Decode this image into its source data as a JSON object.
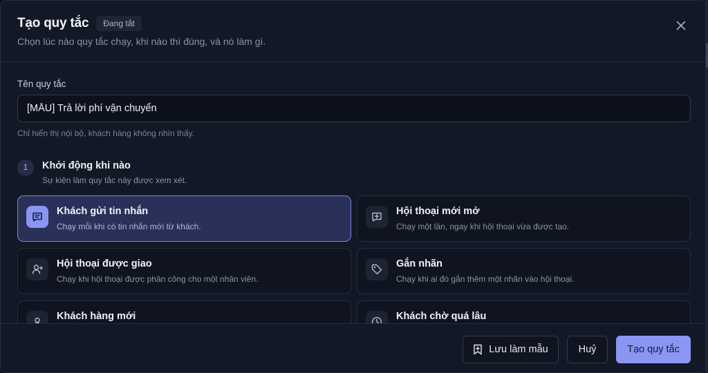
{
  "modal": {
    "title": "Tạo quy tắc",
    "status_badge": "Đang tắt",
    "subtitle": "Chọn lúc nào quy tắc chạy, khi nào thì đúng, và nó làm gì."
  },
  "form": {
    "name_label": "Tên quy tắc",
    "name_value": "[MẪU] Trả lời phí vận chuyển",
    "name_help": "Chỉ hiển thị nội bộ, khách hàng không nhìn thấy."
  },
  "step1": {
    "number": "1",
    "title": "Khởi động khi nào",
    "description": "Sự kiện làm quy tắc này được xem xét."
  },
  "triggers": [
    {
      "title": "Khách gửi tin nhắn",
      "description": "Chạy mỗi khi có tin nhắn mới từ khách.",
      "icon": "message-icon",
      "selected": true
    },
    {
      "title": "Hội thoại mới mở",
      "description": "Chạy một lần, ngay khi hội thoại vừa được tạo.",
      "icon": "message-plus-icon",
      "selected": false
    },
    {
      "title": "Hội thoại được giao",
      "description": "Chạy khi hội thoại được phân công cho một nhân viên.",
      "icon": "user-plus-icon",
      "selected": false
    },
    {
      "title": "Gắn nhãn",
      "description": "Chạy khi ai đó gắn thêm một nhãn vào hội thoại.",
      "icon": "tag-icon",
      "selected": false
    },
    {
      "title": "Khách hàng mới",
      "description": "",
      "icon": "user-icon",
      "selected": false
    },
    {
      "title": "Khách chờ quá lâu",
      "description": "",
      "icon": "clock-icon",
      "selected": false
    }
  ],
  "footer": {
    "save_template_label": "Lưu làm mẫu",
    "cancel_label": "Huỷ",
    "create_label": "Tạo quy tắc"
  },
  "colors": {
    "accent": "#8b96f3",
    "selected_card": "#2a3158",
    "background": "#131826"
  }
}
